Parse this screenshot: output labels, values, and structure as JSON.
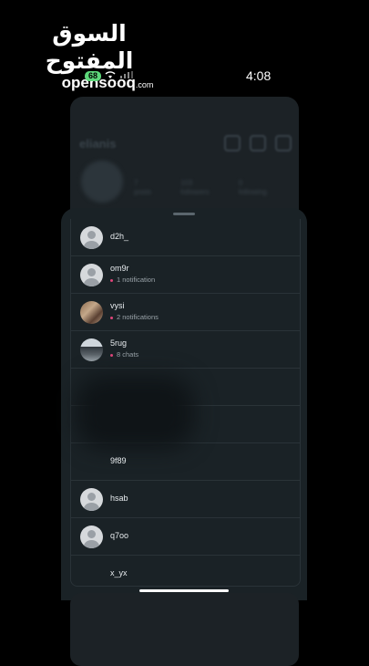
{
  "watermark": {
    "arabic": "السوق المفتوح",
    "latin": "opensooq",
    "tld": ".com"
  },
  "status": {
    "time": "4:08",
    "battery": "68"
  },
  "background_profile": {
    "username": "elianis",
    "stats": [
      {
        "value": "7",
        "label": "posts"
      },
      {
        "value": "103",
        "label": "followers"
      },
      {
        "value": "0",
        "label": "following"
      }
    ]
  },
  "accounts": [
    {
      "username": "d2h_",
      "subtitle": "",
      "avatar": "default"
    },
    {
      "username": "om9r",
      "subtitle": "1 notification",
      "avatar": "default"
    },
    {
      "username": "vysi",
      "subtitle": "2 notifications",
      "avatar": "photo1"
    },
    {
      "username": "5rug",
      "subtitle": "8 chats",
      "avatar": "photo2"
    },
    {
      "username": "",
      "subtitle": "",
      "avatar": "none"
    },
    {
      "username": "",
      "subtitle": "",
      "avatar": "none"
    },
    {
      "username": "9f89",
      "subtitle": "",
      "avatar": "none"
    },
    {
      "username": "hsab",
      "subtitle": "",
      "avatar": "default"
    },
    {
      "username": "q7oo",
      "subtitle": "",
      "avatar": "default"
    },
    {
      "username": "x_yx",
      "subtitle": "",
      "avatar": "none"
    }
  ],
  "colors": {
    "background": "#000000",
    "sheet": "#1a2226",
    "notification_dot": "#e0457b",
    "battery": "#5dd87a"
  }
}
